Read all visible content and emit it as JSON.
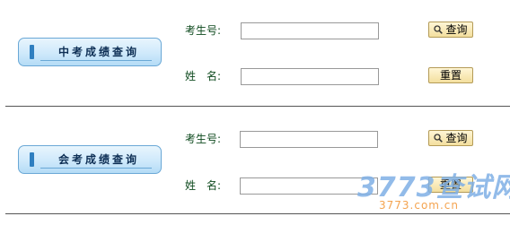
{
  "sections": [
    {
      "title": "中考成绩查询",
      "exam_id_label": "考生号:",
      "name_label": "姓　名:",
      "exam_id_value": "",
      "name_value": "",
      "search_label": "查询",
      "reset_label": "重置"
    },
    {
      "title": "会考成绩查询",
      "exam_id_label": "考生号:",
      "name_label": "姓　名:",
      "exam_id_value": "",
      "name_value": "",
      "search_label": "查询",
      "reset_label": "重置"
    }
  ],
  "watermark": {
    "brand": "3773查试网",
    "url": "3773.com.cn"
  },
  "colors": {
    "badge_border": "#6aa8d6",
    "badge_bar": "#2f7fc0",
    "label_text": "#0e4a1e",
    "button_bg": "#f3df9e",
    "watermark_blue": "#7fb0e6",
    "watermark_orange": "#f39a3d"
  }
}
